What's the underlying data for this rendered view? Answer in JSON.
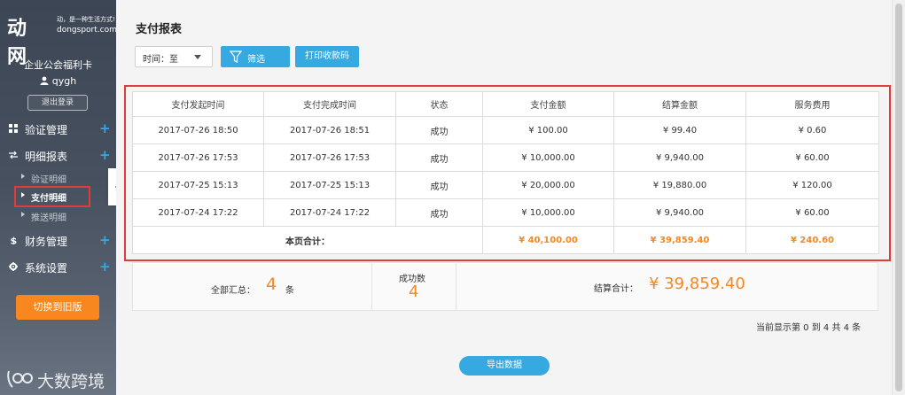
{
  "sidebar": {
    "logo_mark": "动网",
    "logo_slogan": "动，是一种生活方式!",
    "logo_domain": "dongsport.com",
    "org_name": "企业公会福利卡",
    "username": "qygh",
    "logout_label": "退出登录",
    "menu": [
      {
        "label": "验证管理",
        "icon": "grid-icon"
      },
      {
        "label": "明细报表",
        "icon": "transfer-icon"
      },
      {
        "label": "财务管理",
        "icon": "dollar-icon"
      },
      {
        "label": "系统设置",
        "icon": "gear-icon"
      }
    ],
    "submenu": [
      "验证明细",
      "支付明细",
      "推送明细"
    ],
    "switch_label": "切换到旧版",
    "watermark": "大数跨境"
  },
  "main": {
    "title": "支付报表",
    "time_label": "时间：",
    "time_value": "至",
    "filter_label": "筛选",
    "print_label": "打印收款码",
    "table": {
      "headers": [
        "支付发起时间",
        "支付完成时间",
        "状态",
        "支付金额",
        "结算金额",
        "服务费用"
      ],
      "rows": [
        [
          "2017-07-26 18:50",
          "2017-07-26 18:51",
          "成功",
          "¥ 100.00",
          "¥ 99.40",
          "¥ 0.60"
        ],
        [
          "2017-07-26 17:53",
          "2017-07-26 17:53",
          "成功",
          "¥ 10,000.00",
          "¥ 9,940.00",
          "¥ 60.00"
        ],
        [
          "2017-07-25 15:13",
          "2017-07-25 15:13",
          "成功",
          "¥ 20,000.00",
          "¥ 19,880.00",
          "¥ 120.00"
        ],
        [
          "2017-07-24 17:22",
          "2017-07-24 17:22",
          "成功",
          "¥ 10,000.00",
          "¥ 9,940.00",
          "¥ 60.00"
        ]
      ],
      "total_label": "本页合计：",
      "total_values": [
        "¥ 40,100.00",
        "¥ 39,859.40",
        "¥ 240.60"
      ]
    },
    "summary": {
      "total_label": "全部汇总：",
      "total_value": "4",
      "total_unit": "条",
      "success_label": "成功数",
      "success_value": "4",
      "settle_label": "结算合计：",
      "settle_value": "¥ 39,859.40"
    },
    "page_info": "当前显示第 0 到 4 共 4 条",
    "export_label": "导出数据"
  },
  "colors": {
    "accent": "#36a9e1",
    "orange": "#f7871e",
    "highlight": "#e13b3b"
  }
}
